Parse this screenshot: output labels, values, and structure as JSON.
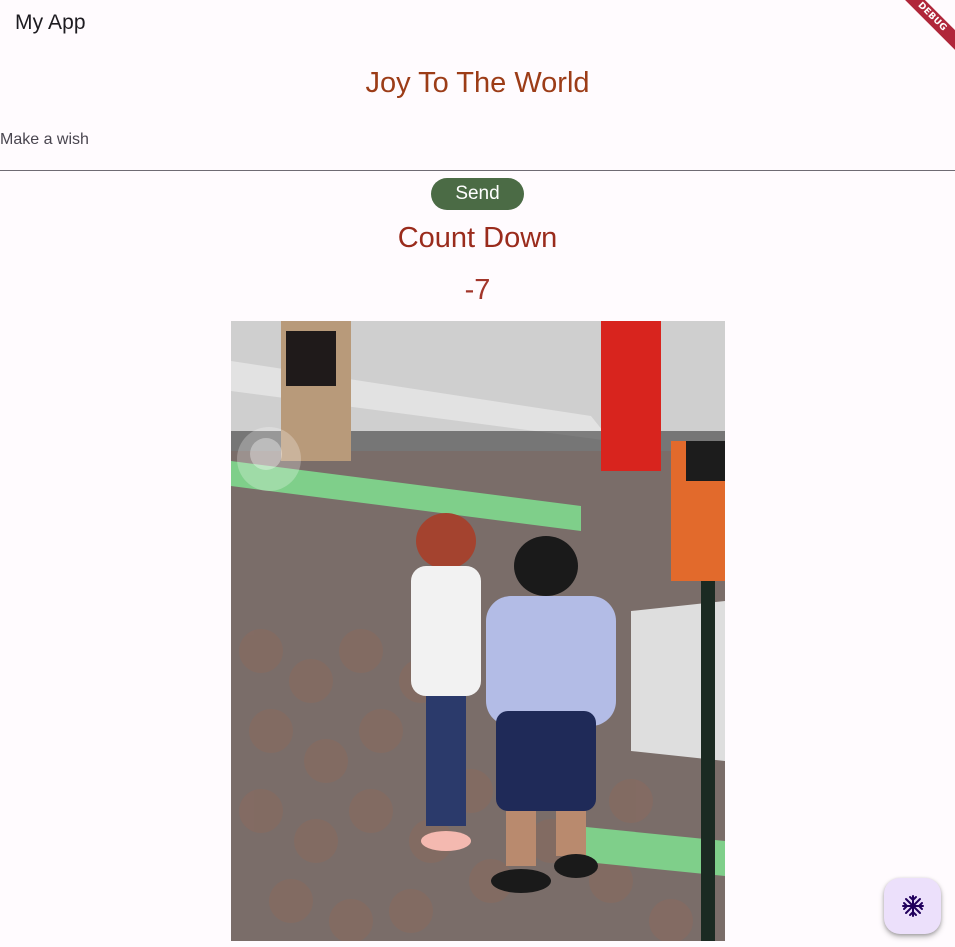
{
  "app_bar": {
    "title": "My App",
    "debug_banner": "DEBUG"
  },
  "main": {
    "heading": "Joy To The World",
    "wish_input": {
      "placeholder": "Make a wish",
      "value": ""
    },
    "send_label": "Send",
    "countdown_title": "Count Down",
    "countdown_value": "-7",
    "video": {
      "description_icon": "video-frame"
    }
  },
  "fab": {
    "icon": "snowflake-icon"
  },
  "colors": {
    "background": "#fffbfe",
    "heading": "#9c3c17",
    "button": "#4b6b45",
    "fab": "#ece0fb",
    "debug_ribbon": "#b0263a"
  }
}
